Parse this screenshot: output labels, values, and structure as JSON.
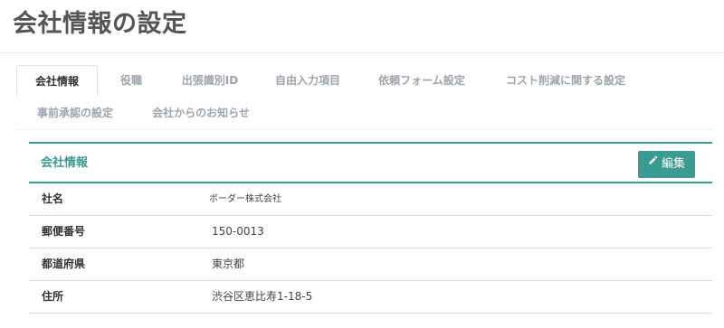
{
  "page": {
    "title": "会社情報の設定"
  },
  "tabs": [
    {
      "label": "会社情報",
      "active": true
    },
    {
      "label": "役職",
      "active": false
    },
    {
      "label": "出張識別ID",
      "active": false
    },
    {
      "label": "自由入力項目",
      "active": false
    },
    {
      "label": "依頼フォーム設定",
      "active": false
    },
    {
      "label": "コスト削減に関する設定",
      "active": false
    },
    {
      "label": "事前承認の設定",
      "active": false
    },
    {
      "label": "会社からのお知らせ",
      "active": false
    }
  ],
  "panel": {
    "title": "会社情報",
    "edit_label": "編集",
    "edit_icon": "pencil-icon",
    "rows": [
      {
        "label": "社名",
        "value": "ボーダー株式会社"
      },
      {
        "label": "郵便番号",
        "value": "150-0013"
      },
      {
        "label": "都道府県",
        "value": "東京都"
      },
      {
        "label": "住所",
        "value": "渋谷区恵比寿1-18-5"
      }
    ]
  },
  "colors": {
    "accent": "#3a9b90",
    "title": "#555555",
    "tab_inactive": "#a0a4ab"
  }
}
